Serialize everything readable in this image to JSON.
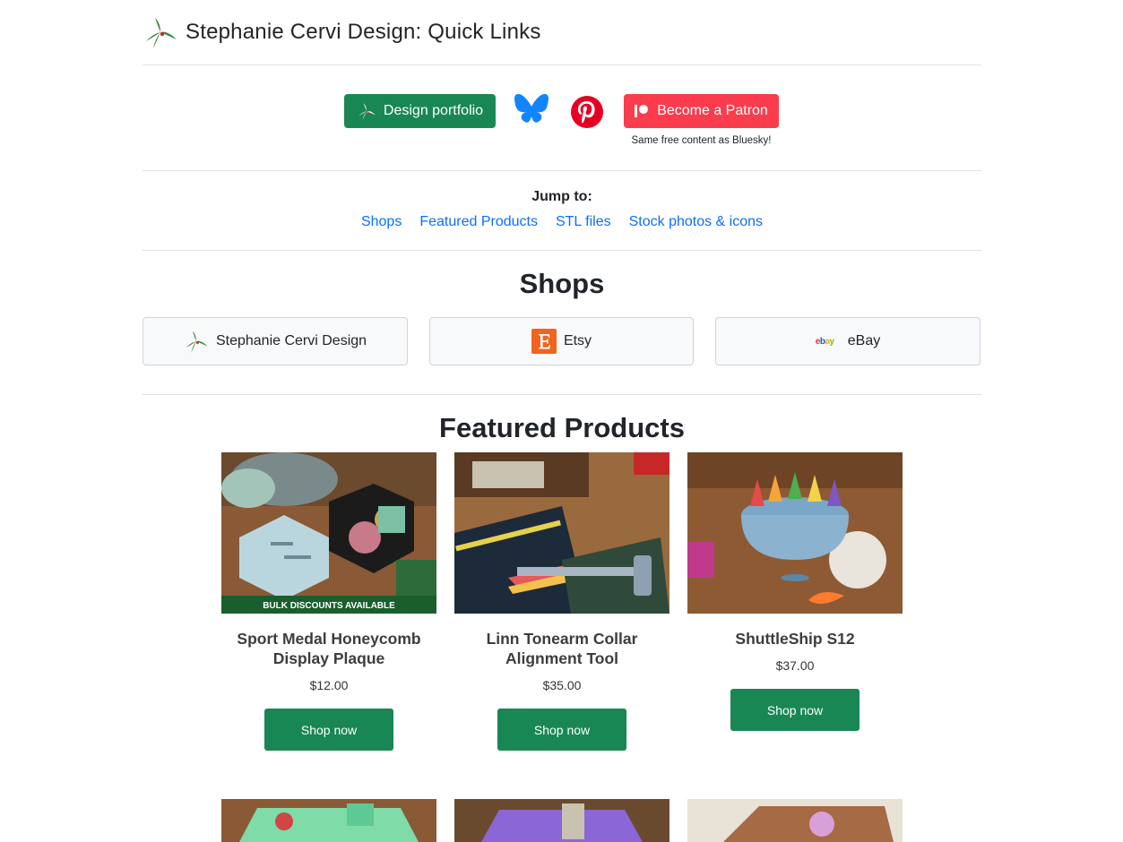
{
  "header": {
    "title": "Stephanie Cervi Design: Quick Links"
  },
  "top_links": {
    "portfolio_label": "Design portfolio",
    "bluesky_icon": "bluesky-butterfly-icon",
    "pinterest_icon": "pinterest-icon",
    "patreon_label": "Become a Patron",
    "patreon_note": "Same free content as Bluesky!"
  },
  "jump": {
    "label": "Jump to:",
    "links": [
      "Shops",
      "Featured Products",
      "STL files",
      "Stock photos & icons"
    ]
  },
  "shops": {
    "title": "Shops",
    "items": [
      {
        "label": "Stephanie Cervi Design",
        "icon": "holly-logo-icon"
      },
      {
        "label": "Etsy",
        "icon": "etsy-icon"
      },
      {
        "label": "eBay",
        "icon": "ebay-icon",
        "icon_text": "ebay"
      }
    ]
  },
  "featured": {
    "title": "Featured Products",
    "products": [
      {
        "name": "Sport Medal Honeycomb Display Plaque",
        "price": "$12.00",
        "button": "Shop now",
        "image_banner": "BULK DISCOUNTS AVAILABLE"
      },
      {
        "name": "Linn Tonearm Collar Alignment Tool",
        "price": "$35.00",
        "button": "Shop now"
      },
      {
        "name": "ShuttleShip S12",
        "price": "$37.00",
        "button": "Shop now"
      }
    ]
  },
  "colors": {
    "green": "#198754",
    "patreon": "#fb3c4c",
    "link": "#0d6efd",
    "bluesky": "#1185fe",
    "pinterest": "#e60023",
    "etsy": "#f1641e"
  }
}
